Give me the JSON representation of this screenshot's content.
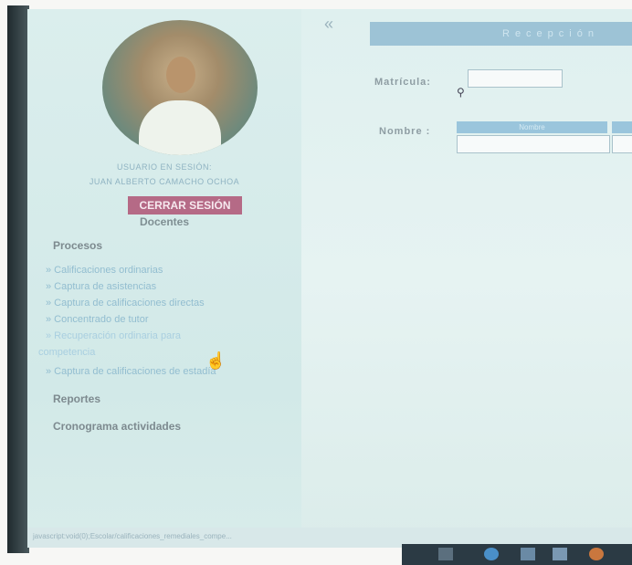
{
  "sidebar": {
    "collapse_icon": "«",
    "user_label": "USUARIO EN SESIÓN:",
    "user_name": "JUAN ALBERTO CAMACHO OCHOA",
    "logout_label": "CERRAR SESIÓN",
    "role_label": "Docentes",
    "sections": {
      "procesos": "Procesos",
      "reportes": "Reportes",
      "cronograma": "Cronograma actividades"
    },
    "items": [
      {
        "label": "» Calificaciones ordinarias"
      },
      {
        "label": "» Captura de asistencias"
      },
      {
        "label": "» Captura de calificaciones directas"
      },
      {
        "label": "» Concentrado de tutor"
      },
      {
        "label": "» Recuperación ordinaria para"
      },
      {
        "label": "competencia"
      },
      {
        "label": "» Captura de calificaciones de estadía"
      }
    ]
  },
  "main": {
    "header_title": "Recepción",
    "matricula_label": "Matrícula:",
    "matricula_value": "",
    "nombre_label": "Nombre :",
    "nombre_column": "Nombre",
    "nombre_value": ""
  },
  "status_bar": {
    "text": "javascript:void(0);Escolar/calificaciones_remediales_compe..."
  },
  "colors": {
    "logout_bg": "#b56a86",
    "header_bg": "#9dc3d6",
    "link_color": "#92bdd0"
  }
}
